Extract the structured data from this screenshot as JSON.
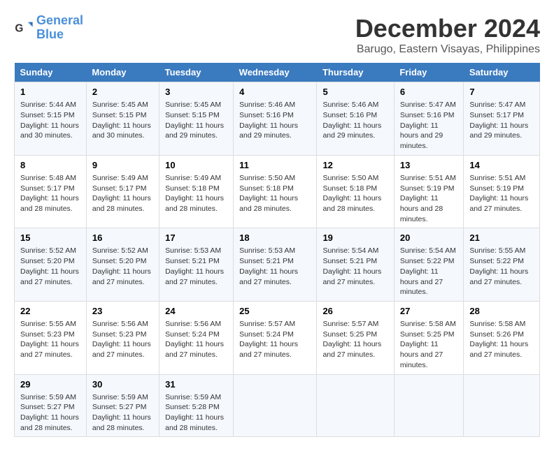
{
  "logo": {
    "line1": "General",
    "line2": "Blue"
  },
  "title": "December 2024",
  "subtitle": "Barugo, Eastern Visayas, Philippines",
  "days_of_week": [
    "Sunday",
    "Monday",
    "Tuesday",
    "Wednesday",
    "Thursday",
    "Friday",
    "Saturday"
  ],
  "weeks": [
    [
      {
        "day": "1",
        "sunrise": "5:44 AM",
        "sunset": "5:15 PM",
        "daylight": "11 hours and 30 minutes."
      },
      {
        "day": "2",
        "sunrise": "5:45 AM",
        "sunset": "5:15 PM",
        "daylight": "11 hours and 30 minutes."
      },
      {
        "day": "3",
        "sunrise": "5:45 AM",
        "sunset": "5:15 PM",
        "daylight": "11 hours and 29 minutes."
      },
      {
        "day": "4",
        "sunrise": "5:46 AM",
        "sunset": "5:16 PM",
        "daylight": "11 hours and 29 minutes."
      },
      {
        "day": "5",
        "sunrise": "5:46 AM",
        "sunset": "5:16 PM",
        "daylight": "11 hours and 29 minutes."
      },
      {
        "day": "6",
        "sunrise": "5:47 AM",
        "sunset": "5:16 PM",
        "daylight": "11 hours and 29 minutes."
      },
      {
        "day": "7",
        "sunrise": "5:47 AM",
        "sunset": "5:17 PM",
        "daylight": "11 hours and 29 minutes."
      }
    ],
    [
      {
        "day": "8",
        "sunrise": "5:48 AM",
        "sunset": "5:17 PM",
        "daylight": "11 hours and 28 minutes."
      },
      {
        "day": "9",
        "sunrise": "5:49 AM",
        "sunset": "5:17 PM",
        "daylight": "11 hours and 28 minutes."
      },
      {
        "day": "10",
        "sunrise": "5:49 AM",
        "sunset": "5:18 PM",
        "daylight": "11 hours and 28 minutes."
      },
      {
        "day": "11",
        "sunrise": "5:50 AM",
        "sunset": "5:18 PM",
        "daylight": "11 hours and 28 minutes."
      },
      {
        "day": "12",
        "sunrise": "5:50 AM",
        "sunset": "5:18 PM",
        "daylight": "11 hours and 28 minutes."
      },
      {
        "day": "13",
        "sunrise": "5:51 AM",
        "sunset": "5:19 PM",
        "daylight": "11 hours and 28 minutes."
      },
      {
        "day": "14",
        "sunrise": "5:51 AM",
        "sunset": "5:19 PM",
        "daylight": "11 hours and 27 minutes."
      }
    ],
    [
      {
        "day": "15",
        "sunrise": "5:52 AM",
        "sunset": "5:20 PM",
        "daylight": "11 hours and 27 minutes."
      },
      {
        "day": "16",
        "sunrise": "5:52 AM",
        "sunset": "5:20 PM",
        "daylight": "11 hours and 27 minutes."
      },
      {
        "day": "17",
        "sunrise": "5:53 AM",
        "sunset": "5:21 PM",
        "daylight": "11 hours and 27 minutes."
      },
      {
        "day": "18",
        "sunrise": "5:53 AM",
        "sunset": "5:21 PM",
        "daylight": "11 hours and 27 minutes."
      },
      {
        "day": "19",
        "sunrise": "5:54 AM",
        "sunset": "5:21 PM",
        "daylight": "11 hours and 27 minutes."
      },
      {
        "day": "20",
        "sunrise": "5:54 AM",
        "sunset": "5:22 PM",
        "daylight": "11 hours and 27 minutes."
      },
      {
        "day": "21",
        "sunrise": "5:55 AM",
        "sunset": "5:22 PM",
        "daylight": "11 hours and 27 minutes."
      }
    ],
    [
      {
        "day": "22",
        "sunrise": "5:55 AM",
        "sunset": "5:23 PM",
        "daylight": "11 hours and 27 minutes."
      },
      {
        "day": "23",
        "sunrise": "5:56 AM",
        "sunset": "5:23 PM",
        "daylight": "11 hours and 27 minutes."
      },
      {
        "day": "24",
        "sunrise": "5:56 AM",
        "sunset": "5:24 PM",
        "daylight": "11 hours and 27 minutes."
      },
      {
        "day": "25",
        "sunrise": "5:57 AM",
        "sunset": "5:24 PM",
        "daylight": "11 hours and 27 minutes."
      },
      {
        "day": "26",
        "sunrise": "5:57 AM",
        "sunset": "5:25 PM",
        "daylight": "11 hours and 27 minutes."
      },
      {
        "day": "27",
        "sunrise": "5:58 AM",
        "sunset": "5:25 PM",
        "daylight": "11 hours and 27 minutes."
      },
      {
        "day": "28",
        "sunrise": "5:58 AM",
        "sunset": "5:26 PM",
        "daylight": "11 hours and 27 minutes."
      }
    ],
    [
      {
        "day": "29",
        "sunrise": "5:59 AM",
        "sunset": "5:27 PM",
        "daylight": "11 hours and 28 minutes."
      },
      {
        "day": "30",
        "sunrise": "5:59 AM",
        "sunset": "5:27 PM",
        "daylight": "11 hours and 28 minutes."
      },
      {
        "day": "31",
        "sunrise": "5:59 AM",
        "sunset": "5:28 PM",
        "daylight": "11 hours and 28 minutes."
      },
      null,
      null,
      null,
      null
    ]
  ]
}
